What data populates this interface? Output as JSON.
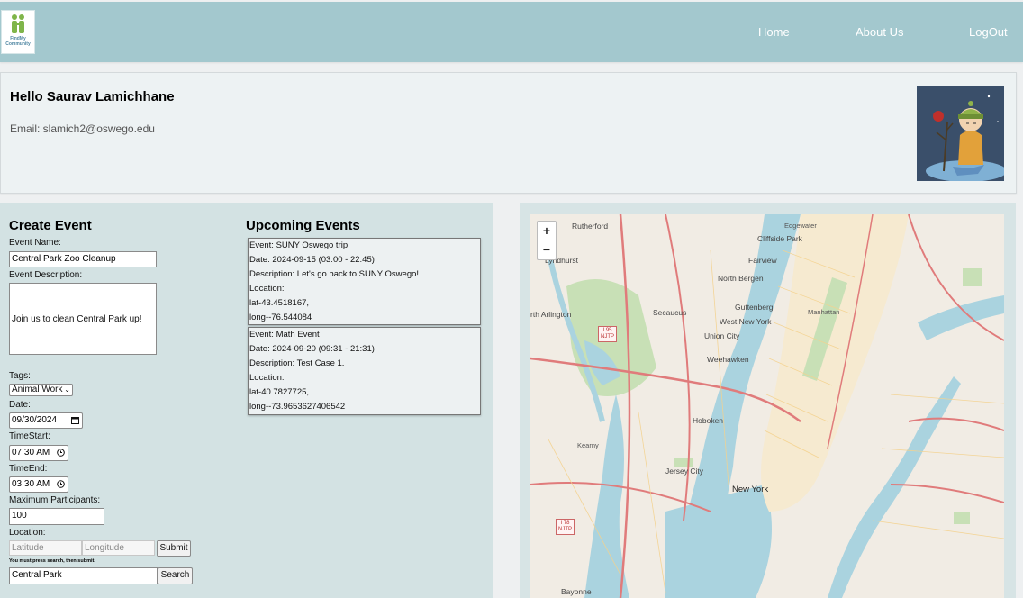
{
  "nav": {
    "logo_text": "FindMy Community",
    "home": "Home",
    "about": "About Us",
    "logout": "LogOut"
  },
  "profile": {
    "greeting": "Hello Saurav Lamichhane",
    "email": "Email: slamich2@oswego.edu"
  },
  "create_event": {
    "title": "Create Event",
    "name_label": "Event Name:",
    "name_value": "Central Park Zoo Cleanup",
    "desc_label": "Event Description:",
    "desc_value": "Join us to clean Central Park up!",
    "tags_label": "Tags:",
    "tags_value": "Animal Work",
    "date_label": "Date:",
    "date_value": "09/30/2024",
    "time_start_label": "TimeStart:",
    "time_start_value": "07:30 AM",
    "time_end_label": "TimeEnd:",
    "time_end_value": "03:30 AM",
    "max_label": "Maximum Participants:",
    "max_value": "100",
    "location_label": "Location:",
    "lat_placeholder": "Latitude",
    "long_placeholder": "Longitude",
    "submit": "Submit",
    "hint": "You must press search, then submit.",
    "search_value": "Central Park",
    "search_button": "Search"
  },
  "upcoming": {
    "title": "Upcoming Events",
    "events": [
      {
        "event": "Event: SUNY Oswego trip",
        "date": "Date: 2024-09-15 (03:00 - 22:45)",
        "description": "Description: Let's go back to SUNY Oswego!",
        "location": "Location:",
        "lat": "lat-43.4518167,",
        "long": "long--76.544084"
      },
      {
        "event": "Event: Math Event",
        "date": "Date: 2024-09-20 (09:31 - 21:31)",
        "description": "Description: Test Case 1.",
        "location": "Location:",
        "lat": "lat-40.7827725,",
        "long": "long--73.9653627406542"
      }
    ]
  },
  "map": {
    "zoom_in": "+",
    "zoom_out": "−",
    "labels": {
      "rutherford": "Rutherford",
      "edgewater": "Edgewater",
      "cliffside": "Cliffside Park",
      "lyndhurst": "Lyndhurst",
      "fairview": "Fairview",
      "north_bergen": "North Bergen",
      "north_arlington": "rth Arlington",
      "secaucus": "Secaucus",
      "guttenberg": "Guttenberg",
      "west_new_york": "West New York",
      "manhattan": "Manhattan",
      "union_city": "Union City",
      "weehawken": "Weehawken",
      "hoboken": "Hoboken",
      "jersey_city": "Jersey City",
      "new_york": "New York",
      "bayonne": "Bayonne",
      "kearny": "Kearny",
      "shield_95": "I 95\nNJTP",
      "shield_78": "I 78\nNJTP"
    },
    "colors": {
      "water": "#aad3df",
      "park": "#c8e0b6",
      "land": "#f1ece4",
      "road": "#e07b7b",
      "street": "#f4d28e"
    }
  }
}
